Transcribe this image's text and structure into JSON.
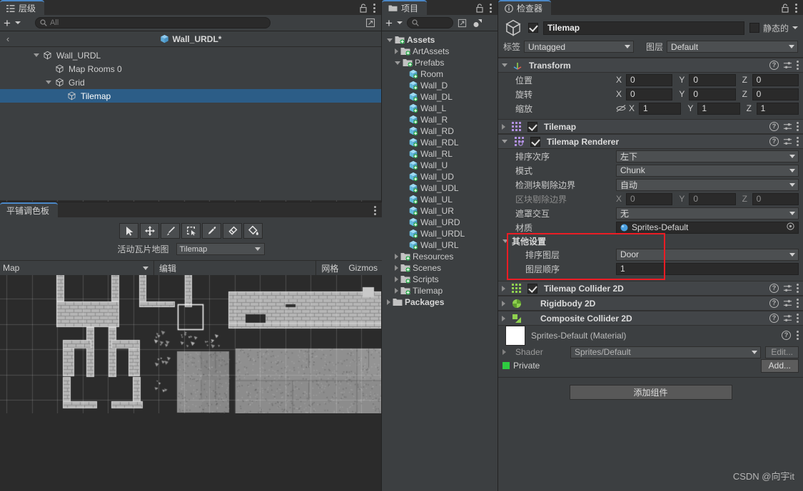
{
  "hierarchy": {
    "tab_label": "层级",
    "tab_icon": "hierarchy-icon",
    "add_label": "+",
    "search_placeholder": "All",
    "breadcrumb": {
      "back": "‹",
      "label": "Wall_URDL*"
    },
    "items": [
      {
        "label": "Wall_URDL",
        "depth": 1,
        "expanded": true,
        "selected": false
      },
      {
        "label": "Map Rooms 0",
        "depth": 2,
        "expanded": null,
        "selected": false
      },
      {
        "label": "Grid",
        "depth": 2,
        "expanded": true,
        "selected": false
      },
      {
        "label": "Tilemap",
        "depth": 3,
        "expanded": null,
        "selected": true
      }
    ]
  },
  "palette": {
    "tab_label": "平铺调色板",
    "tools": [
      {
        "name": "select-tool",
        "glyph": "arrow"
      },
      {
        "name": "move-tool",
        "glyph": "move"
      },
      {
        "name": "brush-tool",
        "glyph": "brush"
      },
      {
        "name": "box-fill-tool",
        "glyph": "boxfill"
      },
      {
        "name": "picker-tool",
        "glyph": "picker"
      },
      {
        "name": "eraser-tool",
        "glyph": "eraser"
      },
      {
        "name": "fill-tool",
        "glyph": "fill"
      }
    ],
    "active_tilemap_label": "活动瓦片地图",
    "active_tilemap_value": "Tilemap",
    "map_dropdown_value": "Map",
    "edit_label": "编辑",
    "grid_label": "网格",
    "gizmos_label": "Gizmos"
  },
  "project": {
    "tab_label": "项目",
    "add_label": "+",
    "search_placeholder": "",
    "items": [
      {
        "label": "Assets",
        "depth": 0,
        "type": "folder",
        "expanded": true,
        "bold": true
      },
      {
        "label": "ArtAssets",
        "depth": 1,
        "type": "folder",
        "expanded": false,
        "bold": false
      },
      {
        "label": "Prefabs",
        "depth": 1,
        "type": "folder",
        "expanded": true,
        "bold": false
      },
      {
        "label": "Room",
        "depth": 2,
        "type": "prefab",
        "expanded": null,
        "bold": false
      },
      {
        "label": "Wall_D",
        "depth": 2,
        "type": "prefab",
        "expanded": null,
        "bold": false
      },
      {
        "label": "Wall_DL",
        "depth": 2,
        "type": "prefab",
        "expanded": null,
        "bold": false
      },
      {
        "label": "Wall_L",
        "depth": 2,
        "type": "prefab",
        "expanded": null,
        "bold": false
      },
      {
        "label": "Wall_R",
        "depth": 2,
        "type": "prefab",
        "expanded": null,
        "bold": false
      },
      {
        "label": "Wall_RD",
        "depth": 2,
        "type": "prefab",
        "expanded": null,
        "bold": false
      },
      {
        "label": "Wall_RDL",
        "depth": 2,
        "type": "prefab",
        "expanded": null,
        "bold": false
      },
      {
        "label": "Wall_RL",
        "depth": 2,
        "type": "prefab",
        "expanded": null,
        "bold": false
      },
      {
        "label": "Wall_U",
        "depth": 2,
        "type": "prefab",
        "expanded": null,
        "bold": false
      },
      {
        "label": "Wall_UD",
        "depth": 2,
        "type": "prefab",
        "expanded": null,
        "bold": false
      },
      {
        "label": "Wall_UDL",
        "depth": 2,
        "type": "prefab",
        "expanded": null,
        "bold": false
      },
      {
        "label": "Wall_UL",
        "depth": 2,
        "type": "prefab",
        "expanded": null,
        "bold": false
      },
      {
        "label": "Wall_UR",
        "depth": 2,
        "type": "prefab",
        "expanded": null,
        "bold": false
      },
      {
        "label": "Wall_URD",
        "depth": 2,
        "type": "prefab",
        "expanded": null,
        "bold": false
      },
      {
        "label": "Wall_URDL",
        "depth": 2,
        "type": "prefab",
        "expanded": null,
        "bold": false
      },
      {
        "label": "Wall_URL",
        "depth": 2,
        "type": "prefab",
        "expanded": null,
        "bold": false
      },
      {
        "label": "Resources",
        "depth": 1,
        "type": "folder",
        "expanded": false,
        "bold": false
      },
      {
        "label": "Scenes",
        "depth": 1,
        "type": "folder",
        "expanded": false,
        "bold": false
      },
      {
        "label": "Scripts",
        "depth": 1,
        "type": "folder",
        "expanded": false,
        "bold": false
      },
      {
        "label": "Tilemap",
        "depth": 1,
        "type": "folder",
        "expanded": false,
        "bold": false
      },
      {
        "label": "Packages",
        "depth": 0,
        "type": "pkg",
        "expanded": false,
        "bold": true
      }
    ]
  },
  "inspector": {
    "tab_label": "检查器",
    "object": {
      "enabled": true,
      "name": "Tilemap",
      "static_label": "静态的",
      "static_checked": false,
      "tag_label": "标签",
      "tag_value": "Untagged",
      "layer_label": "图层",
      "layer_value": "Default"
    },
    "transform": {
      "title": "Transform",
      "position_label": "位置",
      "position": {
        "x": "0",
        "y": "0",
        "z": "0"
      },
      "rotation_label": "旋转",
      "rotation": {
        "x": "0",
        "y": "0",
        "z": "0"
      },
      "scale_label": "缩放",
      "scale": {
        "x": "1",
        "y": "1",
        "z": "1"
      },
      "axes": {
        "x": "X",
        "y": "Y",
        "z": "Z"
      }
    },
    "tilemap_component": {
      "title": "Tilemap",
      "enabled": true,
      "expanded": false
    },
    "tilemap_renderer": {
      "title": "Tilemap Renderer",
      "enabled": true,
      "expanded": true,
      "sort_order_label": "排序次序",
      "sort_order_value": "左下",
      "mode_label": "模式",
      "mode_value": "Chunk",
      "detect_bounds_label": "检测块剔除边界",
      "detect_bounds_value": "自动",
      "chunk_bounds_label": "区块剔除边界",
      "chunk_bounds": {
        "x": "0",
        "y": "0",
        "z": "0"
      },
      "mask_interaction_label": "遮罩交互",
      "mask_interaction_value": "无",
      "material_label": "材质",
      "material_value": "Sprites-Default",
      "other_settings_label": "其他设置",
      "sorting_layer_label": "排序图层",
      "sorting_layer_value": "Door",
      "order_in_layer_label": "图层顺序",
      "order_in_layer_value": "1"
    },
    "tilemap_collider": {
      "title": "Tilemap Collider 2D",
      "enabled": true
    },
    "rigidbody2d": {
      "title": "Rigidbody 2D"
    },
    "composite_collider": {
      "title": "Composite Collider 2D"
    },
    "material_block": {
      "name": "Sprites-Default (Material)",
      "shader_label": "Shader",
      "shader_value": "Sprites/Default",
      "edit_label": "Edit...",
      "private_label": "Private",
      "add_label": "Add..."
    },
    "add_component_label": "添加组件",
    "highlight_color": "#ec1c24"
  },
  "watermark": "CSDN @向宇it"
}
